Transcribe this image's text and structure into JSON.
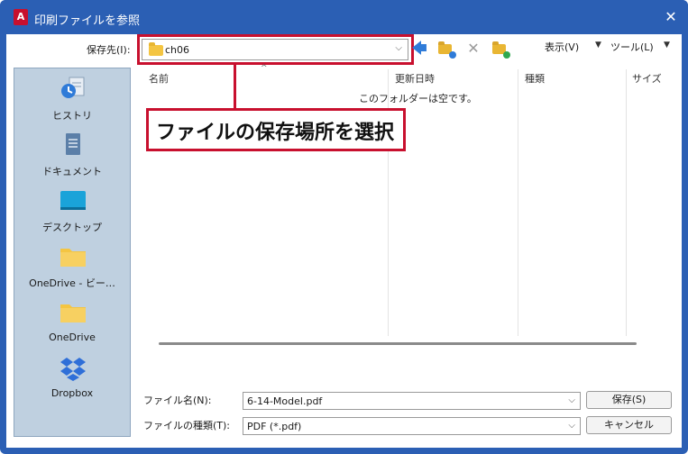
{
  "window": {
    "title": "印刷ファイルを参照",
    "app_icon": "A",
    "close": "✕"
  },
  "toolbar": {
    "save_in_label": "保存先(I):",
    "save_in_value": "ch06",
    "view_menu": "表示(V)",
    "tools_menu": "ツール(L)"
  },
  "places": [
    {
      "label": "ヒストリ",
      "icon": "history-icon"
    },
    {
      "label": "ドキュメント",
      "icon": "documents-icon"
    },
    {
      "label": "デスクトップ",
      "icon": "desktop-icon"
    },
    {
      "label": "OneDrive - ビー…",
      "icon": "folder-icon"
    },
    {
      "label": "OneDrive",
      "icon": "folder-icon"
    },
    {
      "label": "Dropbox",
      "icon": "dropbox-icon"
    }
  ],
  "filelist": {
    "columns": [
      "名前",
      "更新日時",
      "種類",
      "サイズ"
    ],
    "empty_message": "このフォルダーは空です。"
  },
  "callout": {
    "text": "ファイルの保存場所を選択",
    "color": "#c8102e"
  },
  "fields": {
    "filename_label": "ファイル名(N):",
    "filename_value": "6-14-Model.pdf",
    "filetype_label": "ファイルの種類(T):",
    "filetype_value": "PDF (*.pdf)"
  },
  "buttons": {
    "save": "保存(S)",
    "cancel": "キャンセル"
  },
  "colors": {
    "titlebar": "#2b5fb4",
    "places_bg": "#bfd0e0",
    "accent": "#2f7bd8"
  }
}
